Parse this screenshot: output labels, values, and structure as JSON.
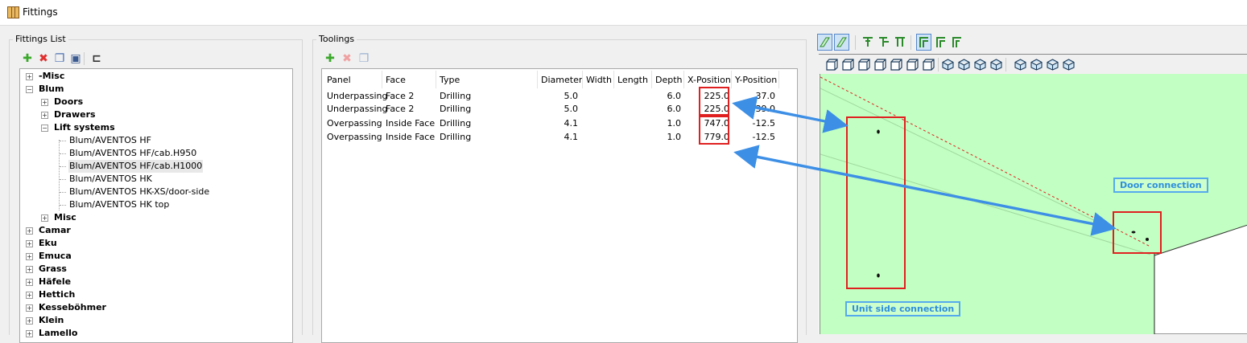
{
  "window": {
    "title": "Fittings"
  },
  "fittings_list": {
    "label": "Fittings List",
    "toolbar": [
      {
        "name": "add-button",
        "icon": "plus-icon",
        "glyph": "✚",
        "color": "#3aa82a"
      },
      {
        "name": "delete-button",
        "icon": "x-icon",
        "glyph": "✖",
        "color": "#e03030"
      },
      {
        "name": "copy-button",
        "icon": "copy-icon",
        "glyph": "❐",
        "color": "#4a6fb0"
      },
      {
        "name": "rename-button",
        "icon": "rename-icon",
        "glyph": "▣",
        "color": "#3a5a90"
      },
      {
        "name": "tree-add-button",
        "icon": "tree-icon",
        "glyph": "⊏",
        "color": "#333333"
      }
    ],
    "tree": [
      {
        "label": "-Misc",
        "level": 0,
        "bold": true,
        "expander": "+"
      },
      {
        "label": "Blum",
        "level": 0,
        "bold": true,
        "expander": "−"
      },
      {
        "label": "Doors",
        "level": 1,
        "bold": true,
        "expander": "+"
      },
      {
        "label": "Drawers",
        "level": 1,
        "bold": true,
        "expander": "+"
      },
      {
        "label": "Lift systems",
        "level": 1,
        "bold": true,
        "expander": "−"
      },
      {
        "label": "Blum/AVENTOS HF",
        "level": 2,
        "bold": false,
        "expander": ""
      },
      {
        "label": "Blum/AVENTOS HF/cab.H950",
        "level": 2,
        "bold": false,
        "expander": ""
      },
      {
        "label": "Blum/AVENTOS HF/cab.H1000",
        "level": 2,
        "bold": false,
        "expander": "",
        "selected": true
      },
      {
        "label": "Blum/AVENTOS HK",
        "level": 2,
        "bold": false,
        "expander": ""
      },
      {
        "label": "Blum/AVENTOS HK-XS/door-side",
        "level": 2,
        "bold": false,
        "expander": ""
      },
      {
        "label": "Blum/AVENTOS HK top",
        "level": 2,
        "bold": false,
        "expander": ""
      },
      {
        "label": "Misc",
        "level": 1,
        "bold": true,
        "expander": "+"
      },
      {
        "label": "Camar",
        "level": 0,
        "bold": true,
        "expander": "+"
      },
      {
        "label": "Eku",
        "level": 0,
        "bold": true,
        "expander": "+"
      },
      {
        "label": "Emuca",
        "level": 0,
        "bold": true,
        "expander": "+"
      },
      {
        "label": "Grass",
        "level": 0,
        "bold": true,
        "expander": "+"
      },
      {
        "label": "Häfele",
        "level": 0,
        "bold": true,
        "expander": "+"
      },
      {
        "label": "Hettich",
        "level": 0,
        "bold": true,
        "expander": "+"
      },
      {
        "label": "Kesseböhmer",
        "level": 0,
        "bold": true,
        "expander": "+"
      },
      {
        "label": "Klein",
        "level": 0,
        "bold": true,
        "expander": "+"
      },
      {
        "label": "Lamello",
        "level": 0,
        "bold": true,
        "expander": "+"
      }
    ]
  },
  "toolings": {
    "label": "Toolings",
    "toolbar": [
      {
        "name": "add-tooling-button",
        "icon": "plus-icon",
        "glyph": "✚",
        "color": "#3aa82a"
      },
      {
        "name": "delete-tooling-button",
        "icon": "x-icon",
        "glyph": "✖",
        "color": "#f0a0a0"
      },
      {
        "name": "copy-tooling-button",
        "icon": "copy-icon",
        "glyph": "❐",
        "color": "#9ab0d0"
      }
    ],
    "columns": [
      "Panel",
      "Face",
      "Type",
      "Diameter",
      "Width",
      "Length",
      "Depth",
      "X-Position",
      "Y-Position"
    ],
    "rows": [
      [
        "Underpassing",
        "Face 2",
        "Drilling",
        "5.0",
        "",
        "",
        "6.0",
        "225.0",
        "37.0"
      ],
      [
        "Underpassing",
        "Face 2",
        "Drilling",
        "5.0",
        "",
        "",
        "6.0",
        "225.0",
        "39.0"
      ],
      [
        "Overpassing",
        "Inside Face",
        "Drilling",
        "4.1",
        "",
        "",
        "1.0",
        "747.0",
        "-12.5"
      ],
      [
        "Overpassing",
        "Inside Face",
        "Drilling",
        "4.1",
        "",
        "",
        "1.0",
        "779.0",
        "-12.5"
      ]
    ]
  },
  "view": {
    "annotations": {
      "door": "Door connection",
      "unit": "Unit side connection"
    },
    "colors": {
      "canvas": "#c2ffc2",
      "highlight": "#e02020",
      "arrow": "#3d8fe6"
    }
  }
}
